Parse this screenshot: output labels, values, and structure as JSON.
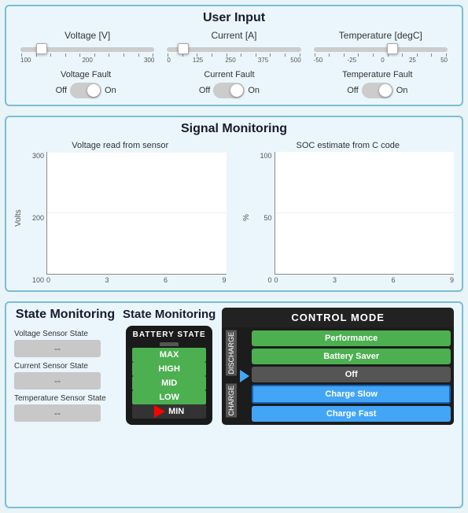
{
  "userInput": {
    "title": "User Input",
    "sliders": [
      {
        "label": "Voltage [V]",
        "thumbPos": "12%",
        "ticks": [
          "100",
          "200",
          "300"
        ]
      },
      {
        "label": "Current [A]",
        "thumbPos": "10%",
        "ticks": [
          "0",
          "125",
          "250",
          "375",
          "500"
        ]
      },
      {
        "label": "Temperature [degC]",
        "thumbPos": "55%",
        "ticks": [
          "-50",
          "-25",
          "0",
          "25",
          "50"
        ]
      }
    ],
    "faults": [
      {
        "label": "Voltage Fault",
        "off": "Off",
        "on": "On"
      },
      {
        "label": "Current Fault",
        "off": "Off",
        "on": "On"
      },
      {
        "label": "Temperature Fault",
        "off": "Off",
        "on": "On"
      }
    ]
  },
  "signalMonitoring": {
    "title": "Signal Monitoring",
    "chart1": {
      "title": "Voltage read from sensor",
      "yLabel": "Volts",
      "yTicks": [
        "300",
        "200",
        "100"
      ],
      "xTicks": [
        "0",
        "3",
        "6",
        "9"
      ]
    },
    "chart2": {
      "title": "SOC estimate from C code",
      "yLabel": "%",
      "yTicks": [
        "100",
        "50",
        "0"
      ],
      "xTicks": [
        "0",
        "3",
        "6",
        "9"
      ]
    }
  },
  "stateMonitoring": {
    "title": "State Monitoring",
    "sensors": [
      {
        "label": "Voltage Sensor State",
        "value": "--"
      },
      {
        "label": "Current Sensor State",
        "value": "--"
      },
      {
        "label": "Temperature Sensor State",
        "value": "--"
      }
    ],
    "batteryState": {
      "title": "BATTERY STATE",
      "levels": [
        "MAX",
        "HIGH",
        "MID",
        "LOW",
        "MIN"
      ]
    },
    "controlMode": {
      "title": "CONTROL MODE",
      "dischargeLabel": "DISCHARGE",
      "chargeLabel": "CHARGE",
      "modes": [
        "Performance",
        "Battery Saver",
        "Off",
        "Charge Slow",
        "Charge Fast"
      ],
      "activeMode": "Charge Slow"
    }
  }
}
